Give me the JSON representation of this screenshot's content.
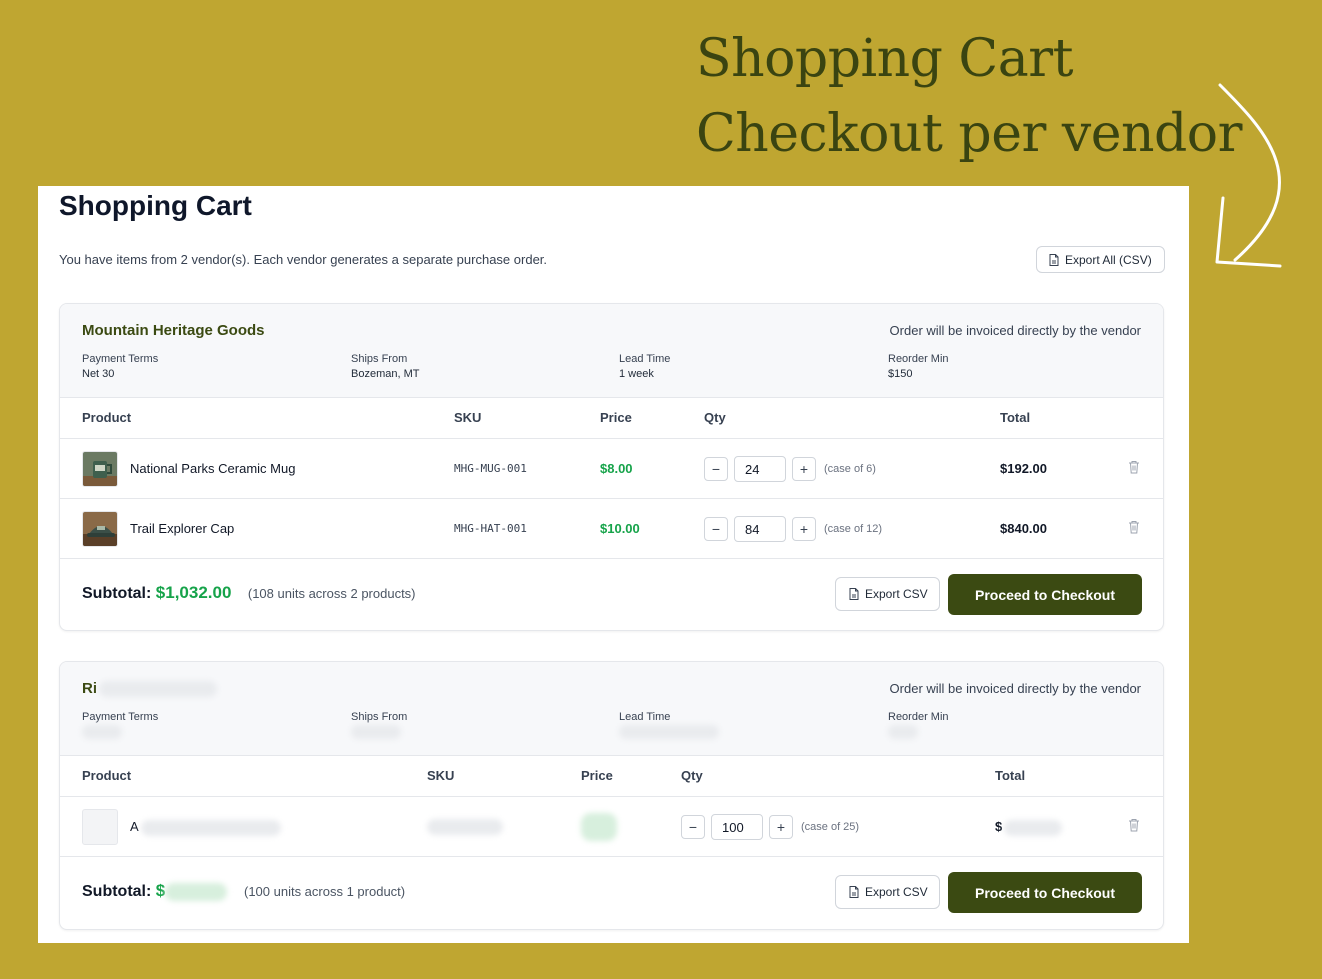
{
  "headline": {
    "line1": "Shopping Cart",
    "line2": "Checkout per vendor"
  },
  "page": {
    "title": "Shopping Cart",
    "intro": "You have items from 2 vendor(s). Each vendor generates a separate purchase order.",
    "export_all_label": "Export All (CSV)"
  },
  "columns": {
    "product": "Product",
    "sku": "SKU",
    "price": "Price",
    "qty": "Qty",
    "total": "Total"
  },
  "vendors": [
    {
      "name": "Mountain Heritage Goods",
      "note": "Order will be invoiced directly by the vendor",
      "meta": {
        "payment_terms_label": "Payment Terms",
        "payment_terms": "Net 30",
        "ships_from_label": "Ships From",
        "ships_from": "Bozeman, MT",
        "lead_time_label": "Lead Time",
        "lead_time": "1 week",
        "reorder_min_label": "Reorder Min",
        "reorder_min": "$150"
      },
      "items": [
        {
          "name": "National Parks Ceramic Mug",
          "sku": "MHG-MUG-001",
          "price": "$8.00",
          "qty": "24",
          "case": "(case of 6)",
          "total": "$192.00"
        },
        {
          "name": "Trail Explorer Cap",
          "sku": "MHG-HAT-001",
          "price": "$10.00",
          "qty": "84",
          "case": "(case of 12)",
          "total": "$840.00"
        }
      ],
      "subtotal_label": "Subtotal:",
      "subtotal": "$1,032.00",
      "units": "(108 units across 2 products)",
      "export_label": "Export CSV",
      "checkout_label": "Proceed to Checkout"
    },
    {
      "name_visible": "Ri",
      "note": "Order will be invoiced directly by the vendor",
      "meta": {
        "payment_terms_label": "Payment Terms",
        "ships_from_label": "Ships From",
        "lead_time_label": "Lead Time",
        "reorder_min_label": "Reorder Min"
      },
      "items": [
        {
          "name_visible": "A",
          "qty": "100",
          "case": "(case of 25)",
          "total_visible": "$"
        }
      ],
      "subtotal_label": "Subtotal:",
      "subtotal_visible": "$",
      "units": "(100 units across 1 product)",
      "export_label": "Export CSV",
      "checkout_label": "Proceed to Checkout"
    }
  ],
  "controls": {
    "minus": "−",
    "plus": "+"
  },
  "colors": {
    "background": "#bfa631",
    "brand": "#3b4a12",
    "price_green": "#16a34a"
  }
}
